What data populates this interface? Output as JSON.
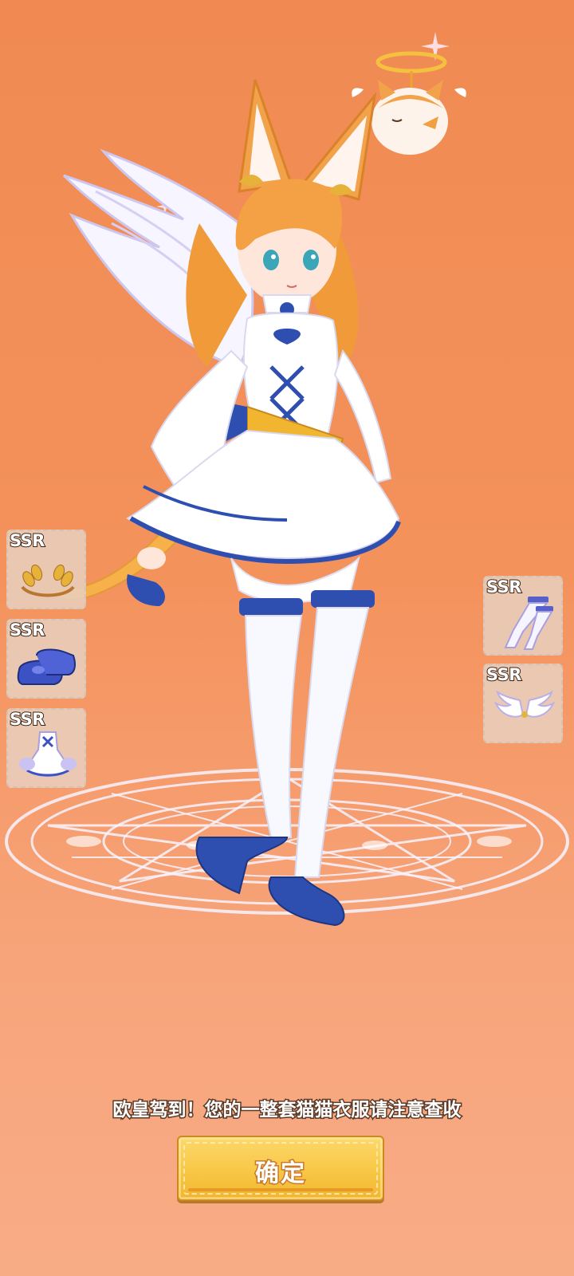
{
  "background": {
    "color_top": "#f08a52",
    "color_bottom": "#f8ac86"
  },
  "left_slots": [
    {
      "rarity": "SSR",
      "item": "laurel-crown",
      "icon": "laurel-crown-icon"
    },
    {
      "rarity": "SSR",
      "item": "blue-shoes",
      "icon": "blue-shoes-icon"
    },
    {
      "rarity": "SSR",
      "item": "angel-dress",
      "icon": "angel-dress-icon"
    }
  ],
  "right_slots": [
    {
      "rarity": "SSR",
      "item": "white-stockings",
      "icon": "stockings-icon"
    },
    {
      "rarity": "SSR",
      "item": "angel-wings",
      "icon": "wings-icon"
    }
  ],
  "message": "欧皇驾到！您的一整套猫猫衣服请注意查收",
  "confirm_button": {
    "label": "确定",
    "color": "#f8c746"
  },
  "accent_colors": {
    "outfit_blue": "#2f4fb0",
    "gold": "#f2b530",
    "hair_orange": "#f09a3a"
  }
}
